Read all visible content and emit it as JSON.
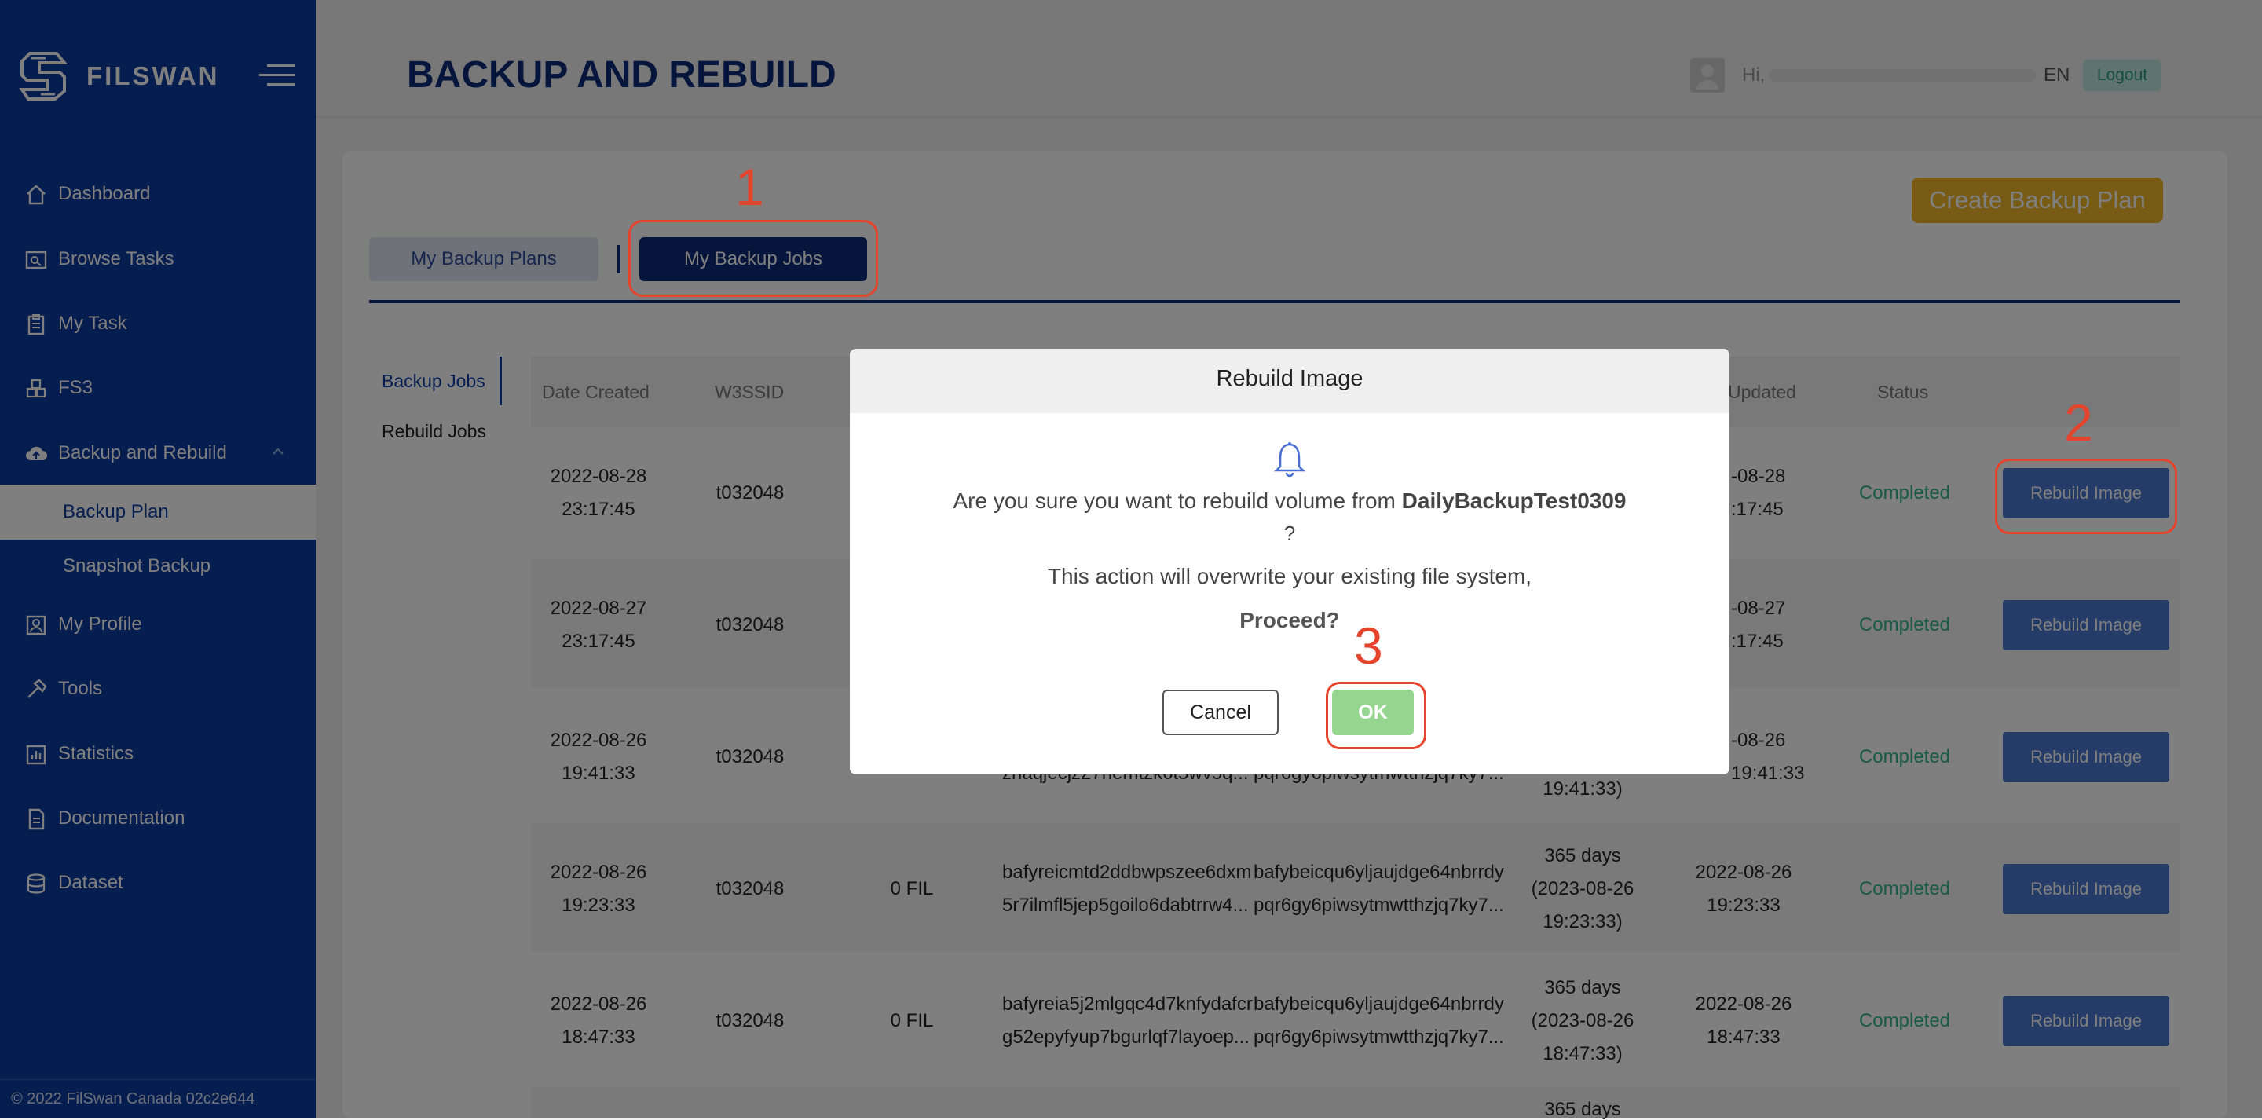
{
  "brand": {
    "name": "FILSWAN"
  },
  "sidebar": {
    "items": [
      {
        "label": "Dashboard",
        "icon": "home-icon"
      },
      {
        "label": "Browse Tasks",
        "icon": "browse-icon"
      },
      {
        "label": "My Task",
        "icon": "clipboard-icon"
      },
      {
        "label": "FS3",
        "icon": "cubes-icon"
      },
      {
        "label": "Backup and Rebuild",
        "icon": "cloud-upload-icon",
        "expanded": true
      },
      {
        "label": "Backup Plan",
        "sub": true,
        "active": true
      },
      {
        "label": "Snapshot Backup",
        "sub": true
      },
      {
        "label": "My Profile",
        "icon": "profile-icon"
      },
      {
        "label": "Tools",
        "icon": "hammer-icon"
      },
      {
        "label": "Statistics",
        "icon": "chart-icon"
      },
      {
        "label": "Documentation",
        "icon": "document-icon"
      },
      {
        "label": "Dataset",
        "icon": "database-icon"
      }
    ],
    "footer": "© 2022 FilSwan Canada 02c2e644"
  },
  "header": {
    "title": "BACKUP AND REBUILD",
    "greeting": "Hi,",
    "lang": "EN",
    "logout": "Logout"
  },
  "main": {
    "create_button": "Create Backup Plan",
    "tabs": [
      "My Backup Plans",
      "My Backup Jobs"
    ],
    "side_tabs": [
      "Backup Jobs",
      "Rebuild Jobs"
    ],
    "columns": [
      "Date Created",
      "W3SSID",
      "Updated",
      "Status"
    ],
    "rows": [
      {
        "date": [
          "2022-08-28",
          "23:17:45"
        ],
        "w3ssid": "t032048",
        "updated": [
          "-08-28",
          ":17:45"
        ],
        "status": "Completed",
        "action": "Rebuild Image"
      },
      {
        "date": [
          "2022-08-27",
          "23:17:45"
        ],
        "w3ssid": "t032048",
        "updated": [
          "-08-27",
          ":17:45"
        ],
        "status": "Completed",
        "action": "Rebuild Image"
      },
      {
        "date": [
          "2022-08-26",
          "19:41:33"
        ],
        "w3ssid": "t032048",
        "cid1": "zhaqjecjz27nemtzk6t5wv5q...",
        "cid2": "pqr6gy6piwsytmwtthzjq7ky7...",
        "duration": "19:41:33)",
        "updated": [
          "-08-26",
          "19:41:33"
        ],
        "status": "Completed",
        "action": "Rebuild Image"
      },
      {
        "date": [
          "2022-08-26",
          "19:23:33"
        ],
        "w3ssid": "t032048",
        "price": "0 FIL",
        "cid1a": "bafyreicmtd2ddbwpszee6dxm",
        "cid1b": "5r7ilmfl5jep5goilo6dabtrrw4...",
        "cid2a": "bafybeicqu6yljaujdge64nbrrdy",
        "cid2b": "pqr6gy6piwsytmwtthzjq7ky7...",
        "dur": [
          "365 days",
          "(2023-08-26",
          "19:23:33)"
        ],
        "updated": [
          "2022-08-26",
          "19:23:33"
        ],
        "status": "Completed",
        "action": "Rebuild Image"
      },
      {
        "date": [
          "2022-08-26",
          "18:47:33"
        ],
        "w3ssid": "t032048",
        "price": "0 FIL",
        "cid1a": "bafyreia5j2mlgqc4d7knfydafcr",
        "cid1b": "g52epyfyup7bgurlqf7layoep...",
        "cid2a": "bafybeicqu6yljaujdge64nbrrdy",
        "cid2b": "pqr6gy6piwsytmwtthzjq7ky7...",
        "dur": [
          "365 days",
          "(2023-08-26",
          "18:47:33)"
        ],
        "updated": [
          "2022-08-26",
          "18:47:33"
        ],
        "status": "Completed",
        "action": "Rebuild Image"
      }
    ],
    "last_row_partial": "365 days"
  },
  "modal": {
    "title": "Rebuild Image",
    "question_prefix": "Are you sure you want to rebuild volume from",
    "volume": "DailyBackupTest0309",
    "question_mark": "?",
    "warning": "This action will overwrite your existing file system,",
    "proceed": "Proceed?",
    "cancel": "Cancel",
    "ok": "OK"
  },
  "annotations": {
    "one": "1",
    "two": "2",
    "three": "3",
    "color": "#e5432b"
  }
}
